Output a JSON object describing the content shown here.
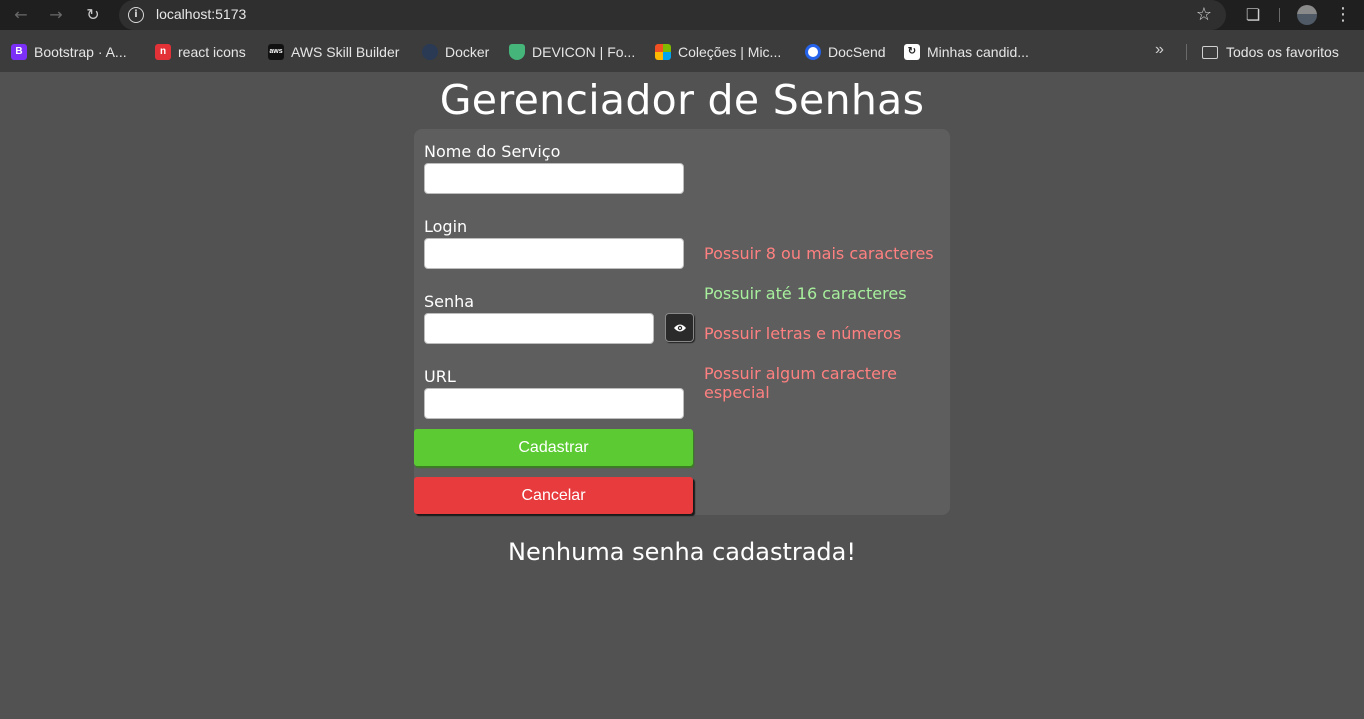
{
  "browser": {
    "url": "localhost:5173",
    "bookmarks": [
      {
        "label": "Bootstrap · A...",
        "icon": "bootstrap-icon"
      },
      {
        "label": "react  icons",
        "icon": "react-icons-icon"
      },
      {
        "label": "AWS Skill Builder",
        "icon": "aws-icon"
      },
      {
        "label": "Docker",
        "icon": "docker-icon"
      },
      {
        "label": "DEVICON | Fo...",
        "icon": "devicon-icon"
      },
      {
        "label": "Coleções | Mic...",
        "icon": "microsoft-icon"
      },
      {
        "label": "DocSend",
        "icon": "docsend-icon"
      },
      {
        "label": "Minhas candid...",
        "icon": "linkedin-style-icon"
      }
    ],
    "all_bookmarks_label": "Todos os favoritos"
  },
  "app": {
    "title": "Gerenciador de Senhas",
    "form": {
      "service_label": "Nome do Serviço",
      "service_value": "",
      "login_label": "Login",
      "login_value": "",
      "password_label": "Senha",
      "password_value": "",
      "url_label": "URL",
      "url_value": "",
      "submit_label": "Cadastrar",
      "cancel_label": "Cancelar"
    },
    "rules": [
      {
        "text": "Possuir 8 ou mais caracteres",
        "valid": false
      },
      {
        "text": "Possuir até 16 caracteres",
        "valid": true
      },
      {
        "text": "Possuir letras e números",
        "valid": false
      },
      {
        "text": "Possuir algum caractere especial",
        "valid": false
      }
    ],
    "empty_message": "Nenhuma senha cadastrada!"
  },
  "colors": {
    "background": "#525252",
    "card": "#5e5e5e",
    "submit": "#5ccb33",
    "cancel": "#e83b3e",
    "rule_invalid": "#ff8080",
    "rule_valid": "#a7ef9d"
  }
}
